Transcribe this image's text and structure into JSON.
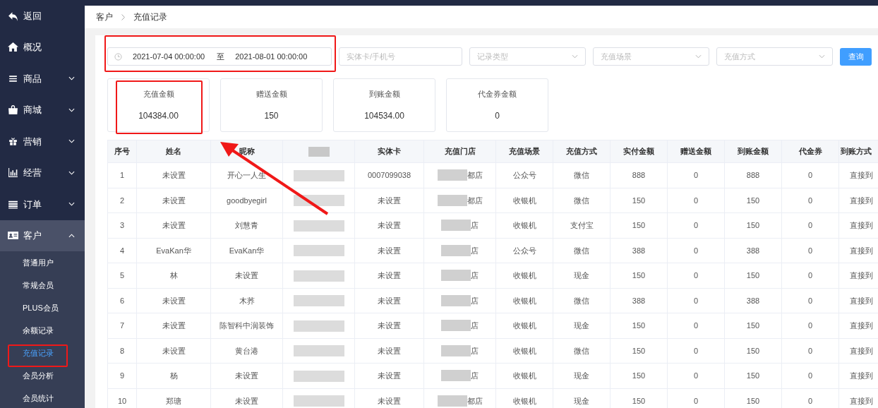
{
  "sidebar": {
    "items": [
      {
        "label": "返回",
        "kind": "link"
      },
      {
        "label": "概况",
        "kind": "link"
      },
      {
        "label": "商品",
        "kind": "group",
        "expanded": false
      },
      {
        "label": "商城",
        "kind": "group",
        "expanded": false
      },
      {
        "label": "营销",
        "kind": "group",
        "expanded": false
      },
      {
        "label": "经营",
        "kind": "group",
        "expanded": false
      },
      {
        "label": "订单",
        "kind": "group",
        "expanded": false
      },
      {
        "label": "客户",
        "kind": "group",
        "expanded": true,
        "children": [
          {
            "label": "普通用户",
            "selected": false
          },
          {
            "label": "常规会员",
            "selected": false
          },
          {
            "label": "PLUS会员",
            "selected": false
          },
          {
            "label": "余额记录",
            "selected": false
          },
          {
            "label": "充值记录",
            "selected": true
          },
          {
            "label": "会员分析",
            "selected": false
          },
          {
            "label": "会员统计",
            "selected": false
          }
        ]
      }
    ]
  },
  "breadcrumb": [
    "客户",
    "充值记录"
  ],
  "filters": {
    "date_start": "2021-07-04 00:00:00",
    "date_separator": "至",
    "date_end": "2021-08-01 00:00:00",
    "card_phone": {
      "placeholder": "实体卡/手机号"
    },
    "selects": [
      {
        "placeholder": "记录类型"
      },
      {
        "placeholder": "充值场景"
      },
      {
        "placeholder": "充值方式"
      }
    ],
    "query_button": "查询"
  },
  "stats": [
    {
      "label": "充值金额",
      "value": "104384.00"
    },
    {
      "label": "赠送金额",
      "value": "150"
    },
    {
      "label": "到账金额",
      "value": "104534.00"
    },
    {
      "label": "代金券金额",
      "value": "0"
    }
  ],
  "table": {
    "columns": [
      "序号",
      "姓名",
      "昵称",
      null,
      "实体卡",
      "充值门店",
      "充值场景",
      "充值方式",
      "实付金额",
      "赠送金额",
      "到账金额",
      "代金券",
      "到账方式"
    ],
    "rows": [
      [
        "1",
        "未设置",
        "开心一人生",
        null,
        "0007099038",
        "都店",
        "公众号",
        "微信",
        "888",
        "0",
        "888",
        "0",
        "直接到"
      ],
      [
        "2",
        "未设置",
        "goodbyegirl",
        null,
        "未设置",
        "都店",
        "收银机",
        "微信",
        "150",
        "0",
        "150",
        "0",
        "直接到"
      ],
      [
        "3",
        "未设置",
        "刘慧青",
        null,
        "未设置",
        "店",
        "收银机",
        "支付宝",
        "150",
        "0",
        "150",
        "0",
        "直接到"
      ],
      [
        "4",
        "EvaKan华",
        "EvaKan华",
        null,
        "未设置",
        "店",
        "公众号",
        "微信",
        "388",
        "0",
        "388",
        "0",
        "直接到"
      ],
      [
        "5",
        "林",
        "未设置",
        null,
        "未设置",
        "店",
        "收银机",
        "现金",
        "150",
        "0",
        "150",
        "0",
        "直接到"
      ],
      [
        "6",
        "未设置",
        "木荞",
        null,
        "未设置",
        "店",
        "收银机",
        "微信",
        "388",
        "0",
        "388",
        "0",
        "直接到"
      ],
      [
        "7",
        "未设置",
        "陈智科中润装饰",
        null,
        "未设置",
        "店",
        "收银机",
        "现金",
        "150",
        "0",
        "150",
        "0",
        "直接到"
      ],
      [
        "8",
        "未设置",
        "黄台港",
        null,
        "未设置",
        "店",
        "收银机",
        "微信",
        "150",
        "0",
        "150",
        "0",
        "直接到"
      ],
      [
        "9",
        "杨",
        "未设置",
        null,
        "未设置",
        "店",
        "收银机",
        "现金",
        "150",
        "0",
        "150",
        "0",
        "直接到"
      ],
      [
        "10",
        "郑瑭",
        "未设置",
        null,
        "未设置",
        "都店",
        "收银机",
        "现金",
        "150",
        "0",
        "150",
        "0",
        "直接到"
      ]
    ]
  },
  "annotations": [
    {
      "kind": "box"
    },
    {
      "kind": "box"
    },
    {
      "kind": "box"
    },
    {
      "kind": "arrow"
    }
  ]
}
